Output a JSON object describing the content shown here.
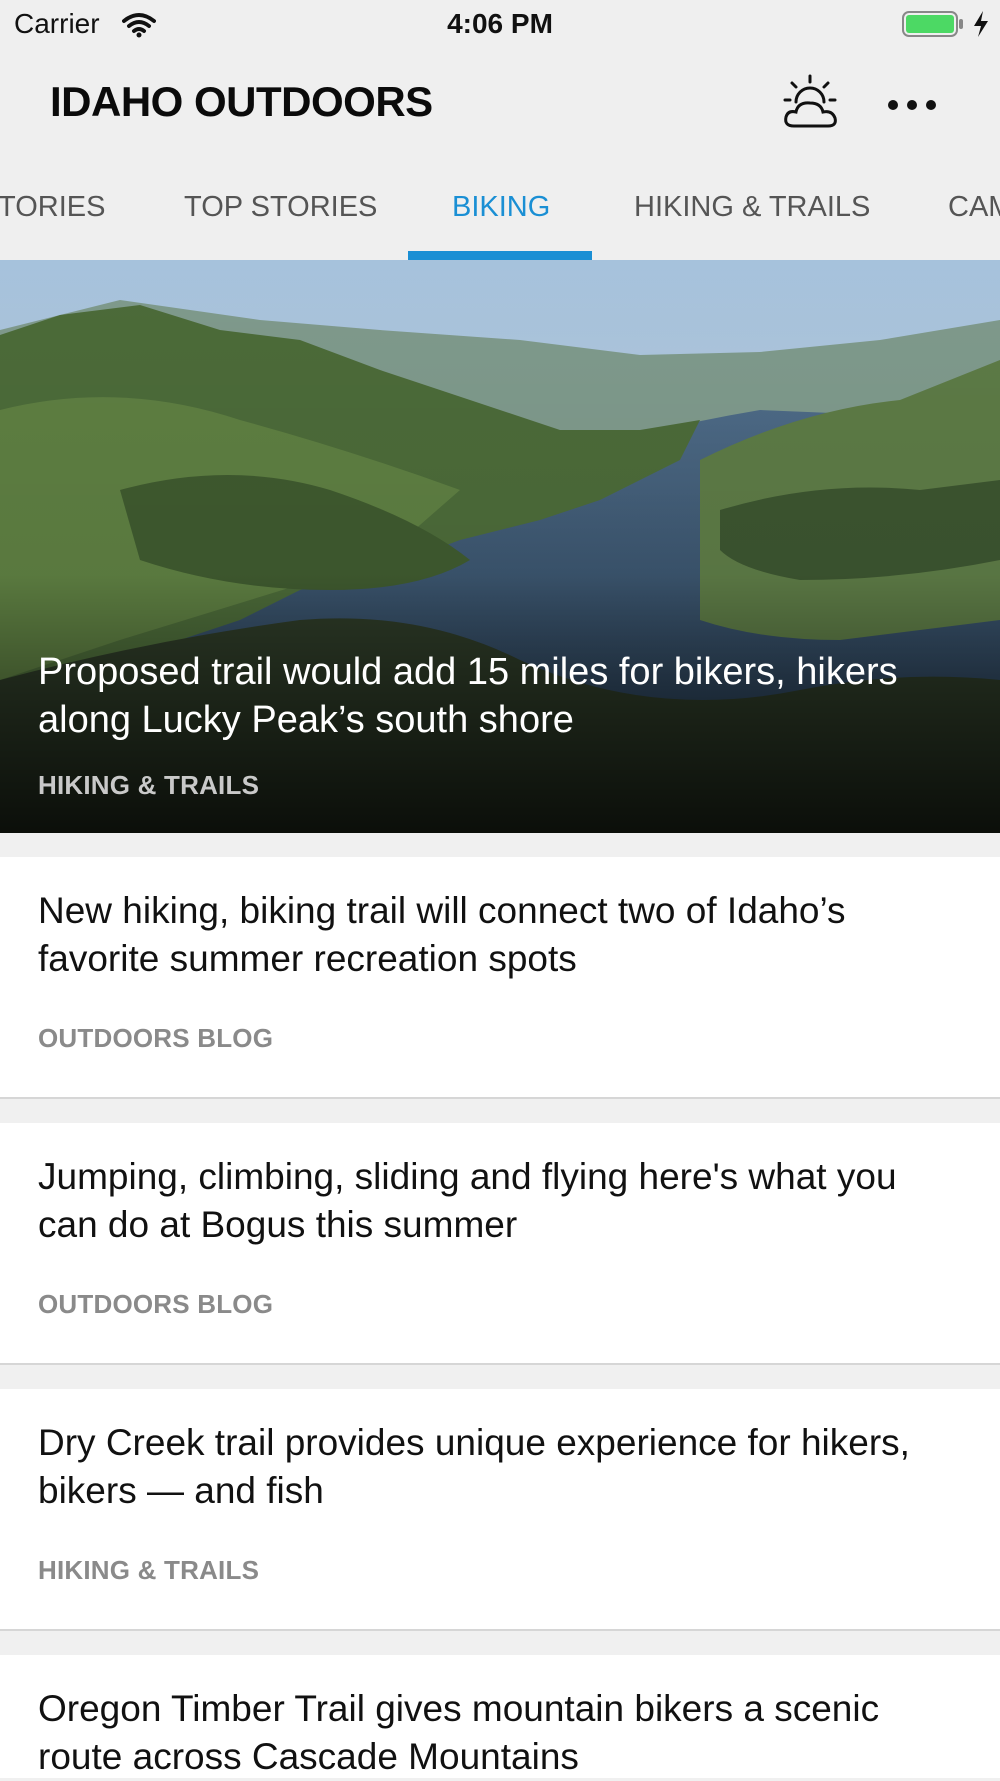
{
  "status_bar": {
    "carrier": "Carrier",
    "time": "4:06 PM"
  },
  "header": {
    "title": "IDAHO OUTDOORS",
    "weather_icon": "partly-cloudy-icon",
    "more_icon": "more-horizontal-icon"
  },
  "tabs": [
    {
      "label": "TORIES",
      "active": false
    },
    {
      "label": "TOP STORIES",
      "active": false
    },
    {
      "label": "BIKING",
      "active": true
    },
    {
      "label": "HIKING & TRAILS",
      "active": false
    },
    {
      "label": "CAM",
      "active": false
    }
  ],
  "colors": {
    "accent": "#1a8fd4"
  },
  "hero": {
    "title": "Proposed trail would add 15 miles for bikers, hikers along Lucky Peak’s south shore",
    "category": "HIKING & TRAILS"
  },
  "stories": [
    {
      "title": "New hiking, biking trail will connect two of Idaho’s favorite summer recreation spots",
      "category": "OUTDOORS BLOG"
    },
    {
      "title": "Jumping, climbing, sliding and flying here's what you can do at Bogus this summer",
      "category": "OUTDOORS BLOG"
    },
    {
      "title": "Dry Creek trail provides unique experience for hikers, bikers — and fish",
      "category": "HIKING & TRAILS"
    },
    {
      "title": "Oregon Timber Trail gives mountain bikers a scenic route across Cascade Mountains",
      "category": ""
    }
  ]
}
